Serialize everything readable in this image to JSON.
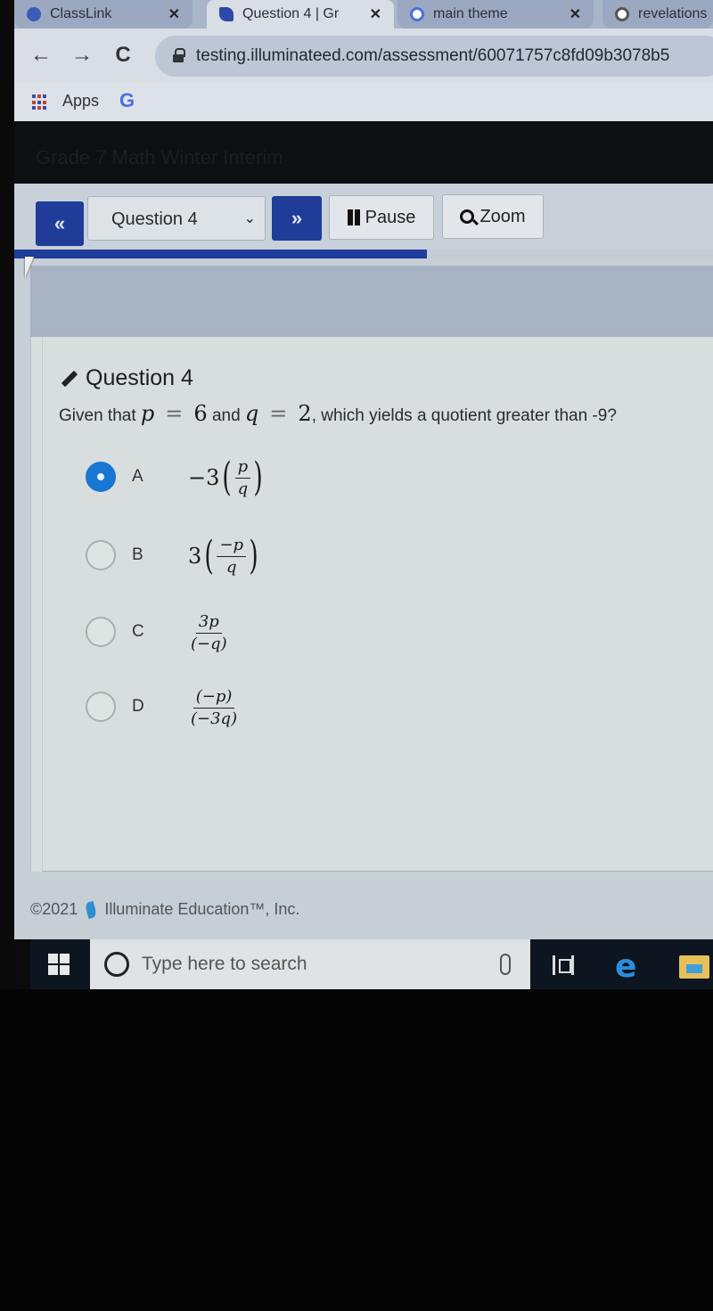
{
  "browser": {
    "tabs": [
      {
        "label": "ClassLink",
        "close": "✕",
        "state": "inactive",
        "favicon_color": "#3b5bb5"
      },
      {
        "label": "Question 4 | Gr",
        "close": "✕",
        "state": "active",
        "favicon_color": "#2d4aa8"
      },
      {
        "label": "main theme",
        "close": "✕",
        "state": "inactive",
        "favicon_color": "#4a72d8"
      },
      {
        "label": "revelations",
        "close": "",
        "state": "inactive",
        "favicon_color": "#555555"
      }
    ],
    "nav": {
      "back": "←",
      "forward": "→",
      "reload": "C"
    },
    "url": "testing.illuminateed.com/assessment/60071757c8fd09b3078b5",
    "bookmarks": {
      "apps_label": "Apps",
      "google_label": "G"
    }
  },
  "app": {
    "title": "Grade 7 Math Winter Interim",
    "controls": {
      "prev_icon": "«",
      "question_select": "Question 4",
      "next_icon": "»",
      "pause_label": "Pause",
      "zoom_label": "Zoom"
    },
    "progress_fraction": 0.59,
    "accent": "#1d3d9a"
  },
  "question": {
    "heading": "Question 4",
    "prompt_prefix": "Given that",
    "var_p": "p",
    "eq_sign": "=",
    "val_p": "6",
    "conj": "and",
    "var_q": "q",
    "val_q": "2",
    "prompt_suffix": ", which yields a quotient greater than -9?",
    "choices": [
      {
        "letter": "A",
        "selected": true,
        "coef": "−3",
        "num": "p",
        "den": "q",
        "paren": true
      },
      {
        "letter": "B",
        "selected": false,
        "coef": "3",
        "num": "−p",
        "den": "q",
        "paren": true
      },
      {
        "letter": "C",
        "selected": false,
        "coef": "",
        "num": "3p",
        "den": "(−q)",
        "paren": false
      },
      {
        "letter": "D",
        "selected": false,
        "coef": "",
        "num": "(−p)",
        "den": "(−3q)",
        "paren": false
      }
    ]
  },
  "footer": {
    "copyright": "©2021",
    "company": "Illuminate Education™, Inc."
  },
  "taskbar": {
    "search_placeholder": "Type here to search"
  }
}
